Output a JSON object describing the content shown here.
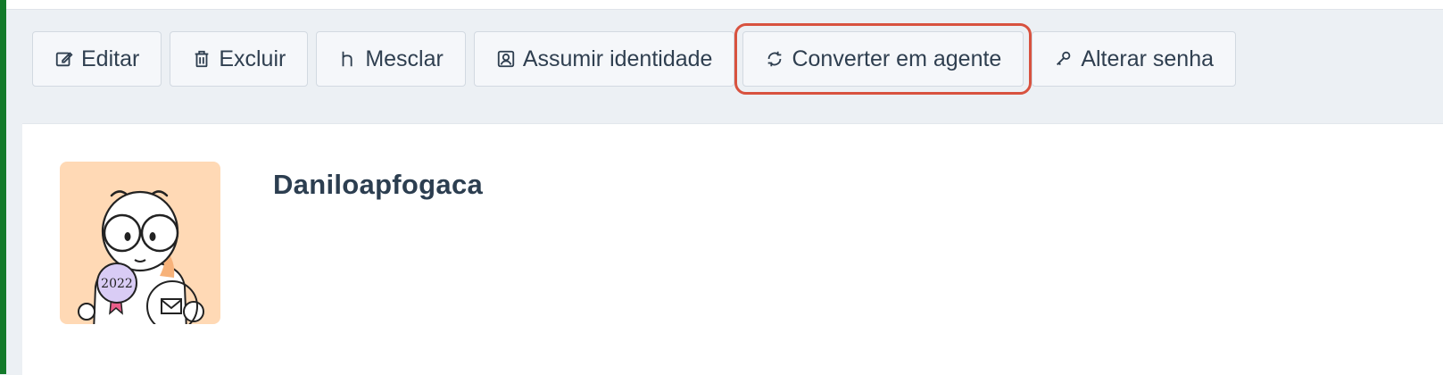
{
  "toolbar": {
    "buttons": [
      {
        "label": "Editar",
        "icon": "edit-icon"
      },
      {
        "label": "Excluir",
        "icon": "trash-icon"
      },
      {
        "label": "Mesclar",
        "icon": "merge-icon"
      },
      {
        "label": "Assumir identidade",
        "icon": "identity-icon"
      },
      {
        "label": "Converter em agente",
        "icon": "convert-icon",
        "highlighted": true
      },
      {
        "label": "Alterar senha",
        "icon": "key-icon"
      }
    ]
  },
  "profile": {
    "name": "Daniloapfogaca",
    "avatar": {
      "badge_text": "2022"
    }
  },
  "colors": {
    "highlight": "#d8523f",
    "left_stripe": "#137a2a",
    "avatar_background": "#ffd9b5",
    "badge_fill": "#d9ccf5"
  }
}
